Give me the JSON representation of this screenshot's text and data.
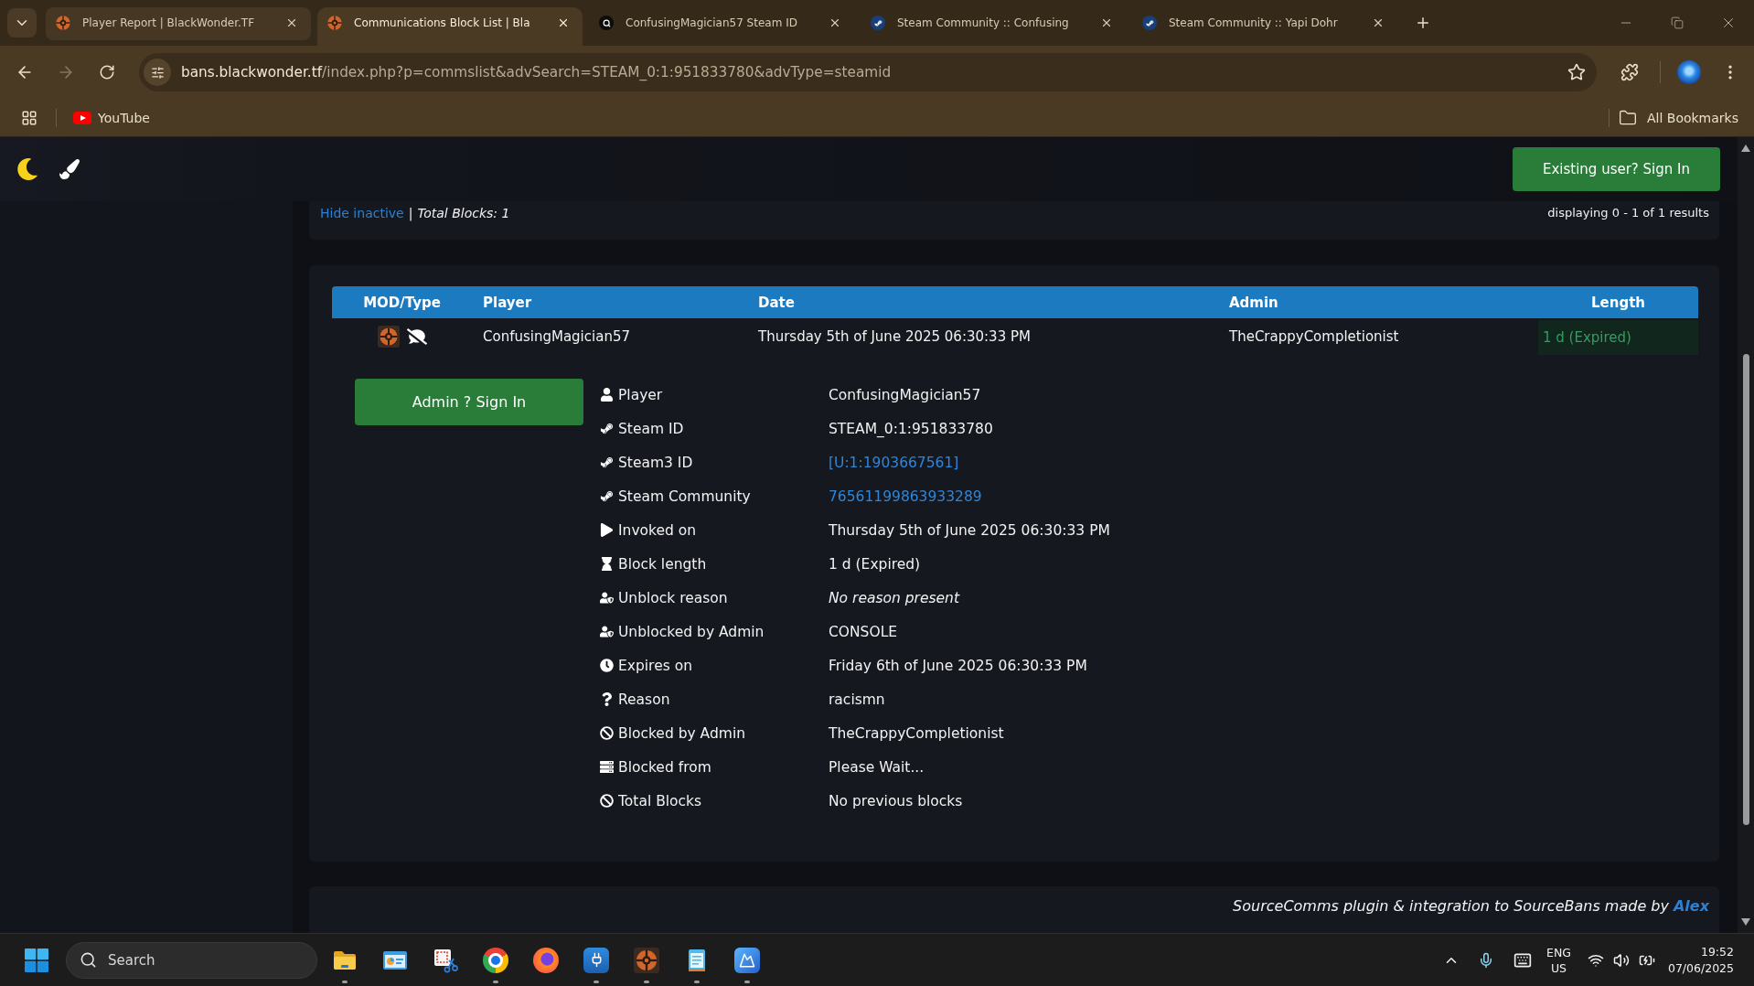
{
  "browser": {
    "tabs": [
      {
        "title": "Player Report | BlackWonder.TF",
        "kind": "game",
        "selected": false,
        "hovered": true
      },
      {
        "title": "Communications Block List | Bla",
        "kind": "game",
        "selected": true,
        "hovered": false
      },
      {
        "title": "ConfusingMagician57 Steam ID",
        "kind": "search",
        "selected": false,
        "hovered": false
      },
      {
        "title": "Steam Community :: Confusing",
        "kind": "steam",
        "selected": false,
        "hovered": false
      },
      {
        "title": "Steam Community :: Yapi Dohr",
        "kind": "steam",
        "selected": false,
        "hovered": false
      }
    ],
    "navigation": {
      "back_enabled": true,
      "forward_enabled": false
    },
    "address": {
      "host": "bans.blackwonder.tf",
      "path": "/index.php?p=commslist&advSearch=STEAM_0:1:951833780&advType=steamid"
    },
    "bookmarks": [
      {
        "label": "YouTube"
      }
    ],
    "all_bookmarks": "All Bookmarks"
  },
  "page": {
    "header": {
      "sign_in_button": "Existing user? Sign In"
    },
    "filter": {
      "hide_inactive": "Hide inactive",
      "separator": "|",
      "total": "Total Blocks: 1",
      "displaying": "displaying 0 - 1 of 1 results"
    },
    "table": {
      "columns": [
        "MOD/Type",
        "Player",
        "Date",
        "Admin",
        "Length"
      ],
      "rows": [
        {
          "player": "ConfusingMagician57",
          "date": "Thursday 5th of June 2025 06:30:33 PM",
          "admin": "TheCrappyCompletionist",
          "length": "1 d (Expired)",
          "expired": true
        }
      ]
    },
    "details": {
      "admin_button": "Admin ? Sign In",
      "rows": [
        {
          "kind": "user",
          "label": "Player",
          "value": {
            "kind": "text",
            "text": "ConfusingMagician57"
          }
        },
        {
          "kind": "steam",
          "label": "Steam ID",
          "value": {
            "kind": "text",
            "text": "STEAM_0:1:951833780"
          }
        },
        {
          "kind": "steam",
          "label": "Steam3 ID",
          "value": {
            "kind": "link",
            "text": "[U:1:1903667561]"
          }
        },
        {
          "kind": "steam",
          "label": "Steam Community",
          "value": {
            "kind": "link",
            "text": "76561199863933289"
          }
        },
        {
          "kind": "play",
          "label": "Invoked on",
          "value": {
            "kind": "text",
            "text": "Thursday 5th of June 2025 06:30:33 PM"
          }
        },
        {
          "kind": "hourglass",
          "label": "Block length",
          "value": {
            "kind": "text",
            "text": "1 d (Expired)"
          }
        },
        {
          "kind": "user-shield",
          "label": "Unblock reason",
          "value": {
            "kind": "note",
            "text": "No reason present"
          }
        },
        {
          "kind": "user-shield",
          "label": "Unblocked by Admin",
          "value": {
            "kind": "text",
            "text": "CONSOLE"
          }
        },
        {
          "kind": "clock",
          "label": "Expires on",
          "value": {
            "kind": "text",
            "text": "Friday 6th of June 2025 06:30:33 PM"
          }
        },
        {
          "kind": "question",
          "label": "Reason",
          "value": {
            "kind": "text",
            "text": "racismn"
          }
        },
        {
          "kind": "ban",
          "label": "Blocked by Admin",
          "value": {
            "kind": "text",
            "text": "TheCrappyCompletionist"
          }
        },
        {
          "kind": "server",
          "label": "Blocked from",
          "value": {
            "kind": "text",
            "text": "Please Wait..."
          }
        },
        {
          "kind": "ban",
          "label": "Total Blocks",
          "value": {
            "kind": "text",
            "text": "No previous blocks"
          }
        }
      ]
    },
    "footer": {
      "text": "SourceComms plugin & integration to SourceBans made by",
      "link": "Alex"
    }
  },
  "taskbar": {
    "search_placeholder": "Search",
    "apps": [
      {
        "kind": "folder",
        "running": true
      },
      {
        "kind": "panel",
        "running": false
      },
      {
        "kind": "snip",
        "running": false
      },
      {
        "kind": "browser",
        "running": true
      },
      {
        "kind": "firefox",
        "running": false
      },
      {
        "kind": "plug",
        "running": true
      },
      {
        "kind": "game",
        "running": true
      },
      {
        "kind": "notepad",
        "running": true
      },
      {
        "kind": "photos",
        "running": true
      }
    ],
    "language": [
      "ENG",
      "US"
    ],
    "time": "19:52",
    "date": "07/06/2025"
  }
}
